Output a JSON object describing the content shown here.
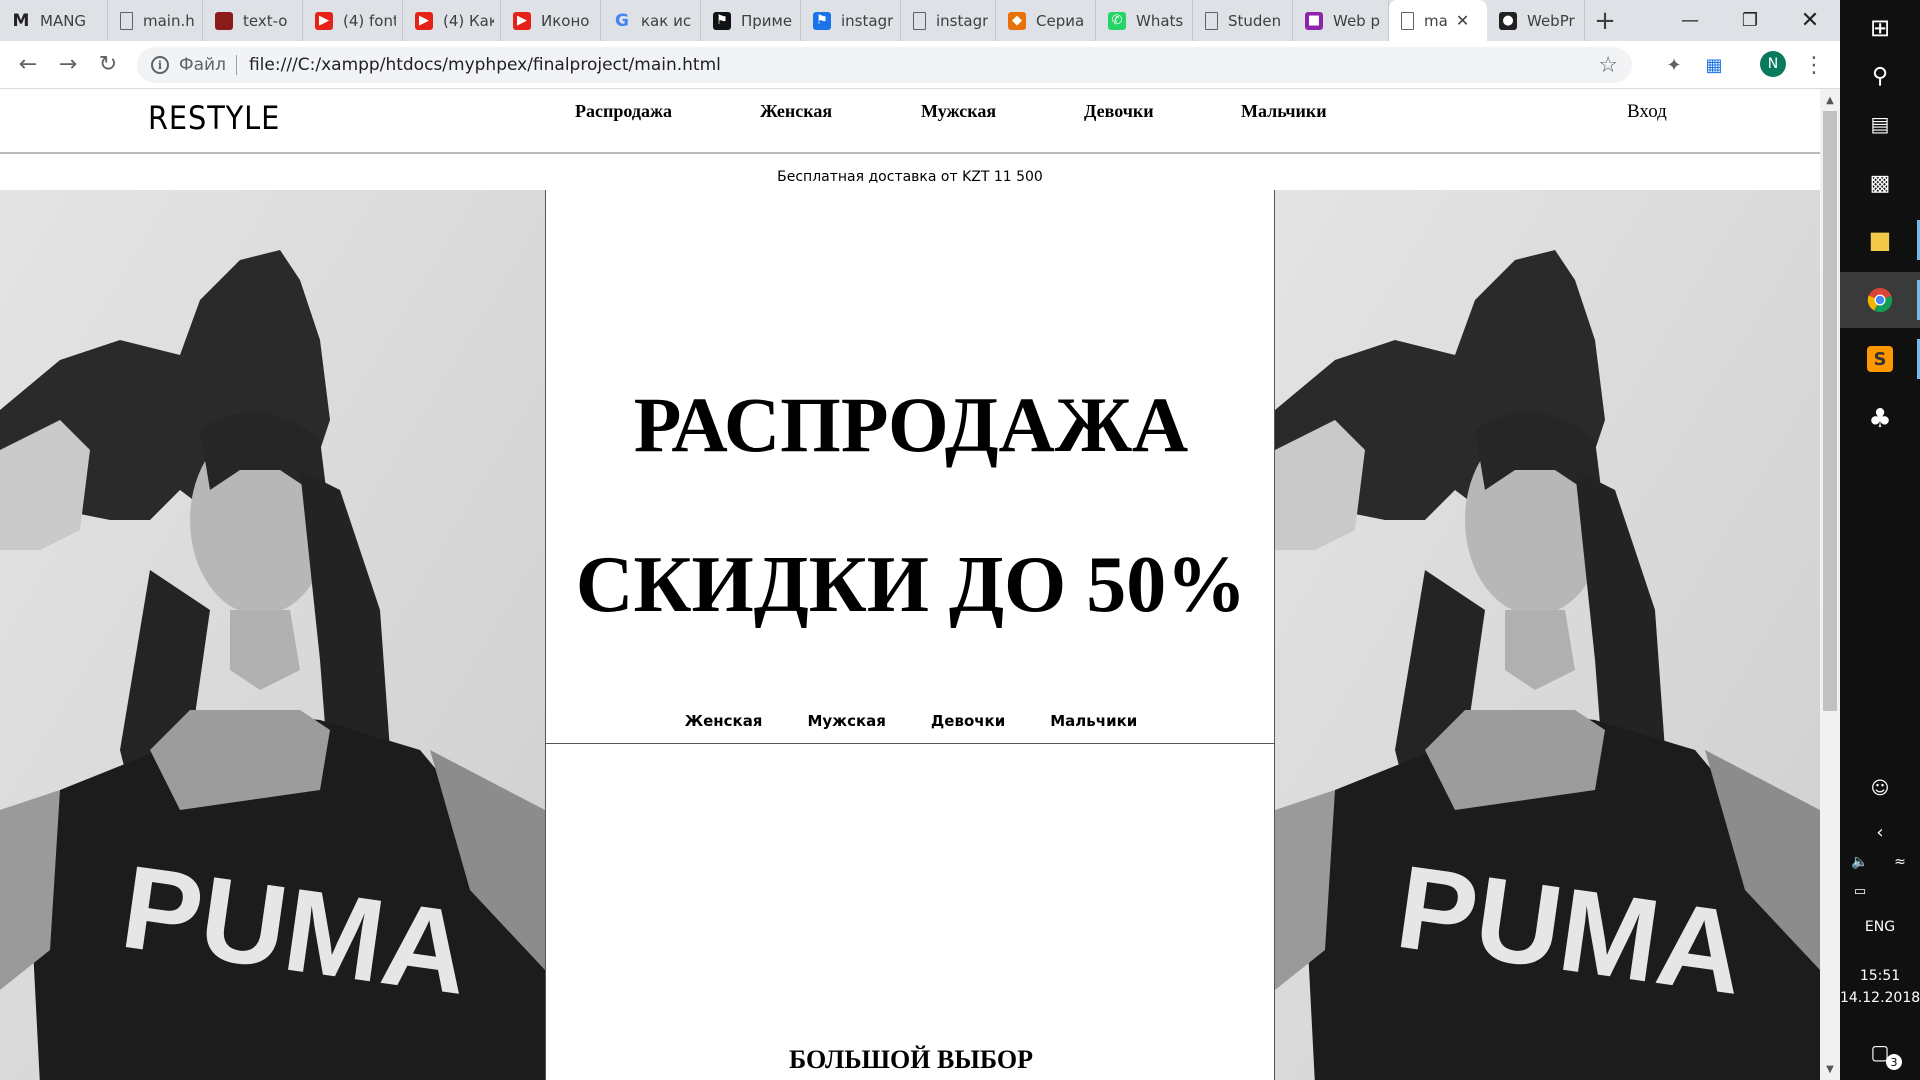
{
  "browser": {
    "tabs": [
      {
        "title": "MANG",
        "icon": "gmail-icon",
        "icon_char": "M",
        "icon_color": "#222222",
        "width": 108
      },
      {
        "title": "main.h",
        "icon": "page-icon",
        "icon_char": "",
        "icon_color": "",
        "width": 95
      },
      {
        "title": "text-o",
        "icon": "blocks-icon",
        "icon_char": "",
        "icon_color": "#8b1a1a",
        "width": 100
      },
      {
        "title": "(4) font",
        "icon": "youtube-icon",
        "icon_char": "▶",
        "icon_color": "#e62117",
        "width": 100
      },
      {
        "title": "(4) Как",
        "icon": "youtube-icon",
        "icon_char": "▶",
        "icon_color": "#e62117",
        "width": 98
      },
      {
        "title": "Иконо",
        "icon": "youtube-icon",
        "icon_char": "▶",
        "icon_color": "#e62117",
        "width": 100
      },
      {
        "title": "как ис",
        "icon": "google-icon",
        "icon_char": "G",
        "icon_color": "#4285f4",
        "width": 100
      },
      {
        "title": "Приме",
        "icon": "flag-icon",
        "icon_char": "⚑",
        "icon_color": "#111111",
        "width": 100
      },
      {
        "title": "instagr",
        "icon": "flag-icon",
        "icon_char": "⚑",
        "icon_color": "#1a73e8",
        "width": 100
      },
      {
        "title": "instagr",
        "icon": "page-icon",
        "icon_char": "",
        "icon_color": "",
        "width": 95
      },
      {
        "title": "Сериа",
        "icon": "fox-icon",
        "icon_char": "◆",
        "icon_color": "#e8710a",
        "width": 100
      },
      {
        "title": "Whats",
        "icon": "whatsapp-icon",
        "icon_char": "✆",
        "icon_color": "#25d366",
        "width": 97
      },
      {
        "title": "Studen",
        "icon": "page-icon",
        "icon_char": "",
        "icon_color": "",
        "width": 100
      },
      {
        "title": "Web p",
        "icon": "classroom-icon",
        "icon_char": "■",
        "icon_color": "#8e24aa",
        "width": 96
      },
      {
        "title": "ma",
        "icon": "page-icon",
        "icon_char": "",
        "icon_color": "",
        "width": 98,
        "active": true
      },
      {
        "title": "WebPr",
        "icon": "github-icon",
        "icon_char": "●",
        "icon_color": "#222222",
        "width": 98
      }
    ],
    "address": {
      "scheme": "Файл",
      "url": "file:///C:/xampp/htdocs/myphpex/finalproject/main.html"
    },
    "profile_initial": "N"
  },
  "page": {
    "logo": "RESTYLE",
    "nav": [
      "Распродажа",
      "Женская",
      "Мужская",
      "Девочки",
      "Мальчики"
    ],
    "login": "Вход",
    "shipping_note": "Бесплатная доставка от KZT 11 500",
    "sale_title": "РАСПРОДАЖА",
    "sale_subtitle": "СКИДКИ ДО 50%",
    "sub_nav": [
      "Женская",
      "Мужская",
      "Девочки",
      "Мальчики"
    ],
    "section2_title": "БОЛЬШОЙ ВЫБОР",
    "photo_shirt_text": "PUMA"
  },
  "taskbar": {
    "lang": "ENG",
    "time": "15:51",
    "date": "14.12.2018",
    "notifications": "3"
  }
}
